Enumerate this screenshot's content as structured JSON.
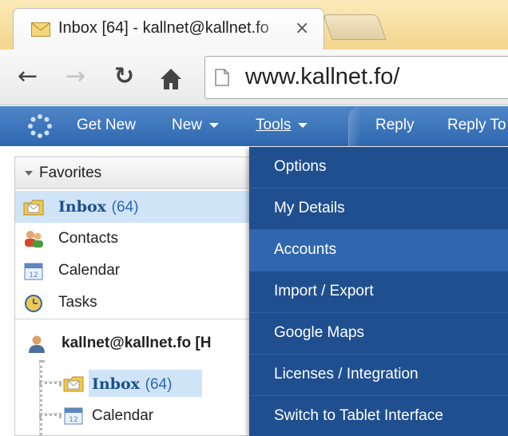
{
  "browser": {
    "tab_title": "Inbox [64] - kallnet@kallnet.fo",
    "tab_close": "×",
    "url": "www.kallnet.fo/"
  },
  "appbar": {
    "get_new": "Get New",
    "new": "New",
    "tools": "Tools",
    "reply": "Reply",
    "reply_to": "Reply To"
  },
  "nav": {
    "favorites_label": "Favorites",
    "favorites": [
      {
        "label": "Inbox",
        "count": "(64)"
      },
      {
        "label": "Contacts"
      },
      {
        "label": "Calendar"
      },
      {
        "label": "Tasks"
      }
    ],
    "account": "kallnet@kallnet.fo [H",
    "account_children": [
      {
        "label": "Inbox",
        "count": "(64)"
      },
      {
        "label": "Calendar"
      }
    ]
  },
  "tools_menu": {
    "items": [
      "Options",
      "My Details",
      "Accounts",
      "Import / Export",
      "Google Maps",
      "Licenses / Integration",
      "Switch to Tablet Interface"
    ],
    "highlighted_index": 2
  },
  "colors": {
    "appbar_blue": "#3a72b8",
    "menu_blue": "#1f4f8f",
    "menu_highlight": "#2f66ae",
    "selection": "#cfe4f7",
    "tab_strip": "#f3d58d"
  },
  "icons": {
    "tab_favicon": "envelope-icon",
    "back": "arrow-left-icon",
    "forward": "arrow-right-icon",
    "reload": "reload-icon",
    "home": "home-icon",
    "page": "page-icon",
    "app_logo": "spinner-dots-icon",
    "inbox": "inbox-folder-icon",
    "contacts": "contacts-icon",
    "calendar": "calendar-icon",
    "tasks": "tasks-clock-icon",
    "account": "user-icon"
  }
}
